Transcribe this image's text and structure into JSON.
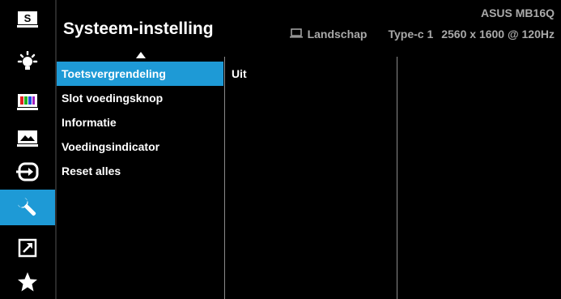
{
  "header": {
    "title": "Systeem-instelling",
    "model": "ASUS MB16Q",
    "orientation": "Landschap",
    "input": "Type-c 1",
    "resolution": "2560 x 1600 @ 120Hz"
  },
  "sidebar": {
    "items": [
      {
        "icon": "splendid-icon",
        "label": "S"
      },
      {
        "icon": "brightness-icon"
      },
      {
        "icon": "color-icon"
      },
      {
        "icon": "image-icon"
      },
      {
        "icon": "input-select-icon"
      },
      {
        "icon": "system-setup-icon",
        "active": true
      },
      {
        "icon": "shortcut-icon"
      },
      {
        "icon": "my-favorite-icon"
      }
    ]
  },
  "menu": {
    "items": [
      {
        "label": "Toetsvergrendeling",
        "selected": true
      },
      {
        "label": "Slot voedingsknop"
      },
      {
        "label": "Informatie"
      },
      {
        "label": "Voedingsindicator"
      },
      {
        "label": "Reset alles"
      }
    ]
  },
  "options": {
    "current_value": "Uit"
  },
  "colors": {
    "background": "#000000",
    "accent": "#1e9ad6",
    "text": "#ffffff",
    "muted_text": "#a9a9a9"
  }
}
